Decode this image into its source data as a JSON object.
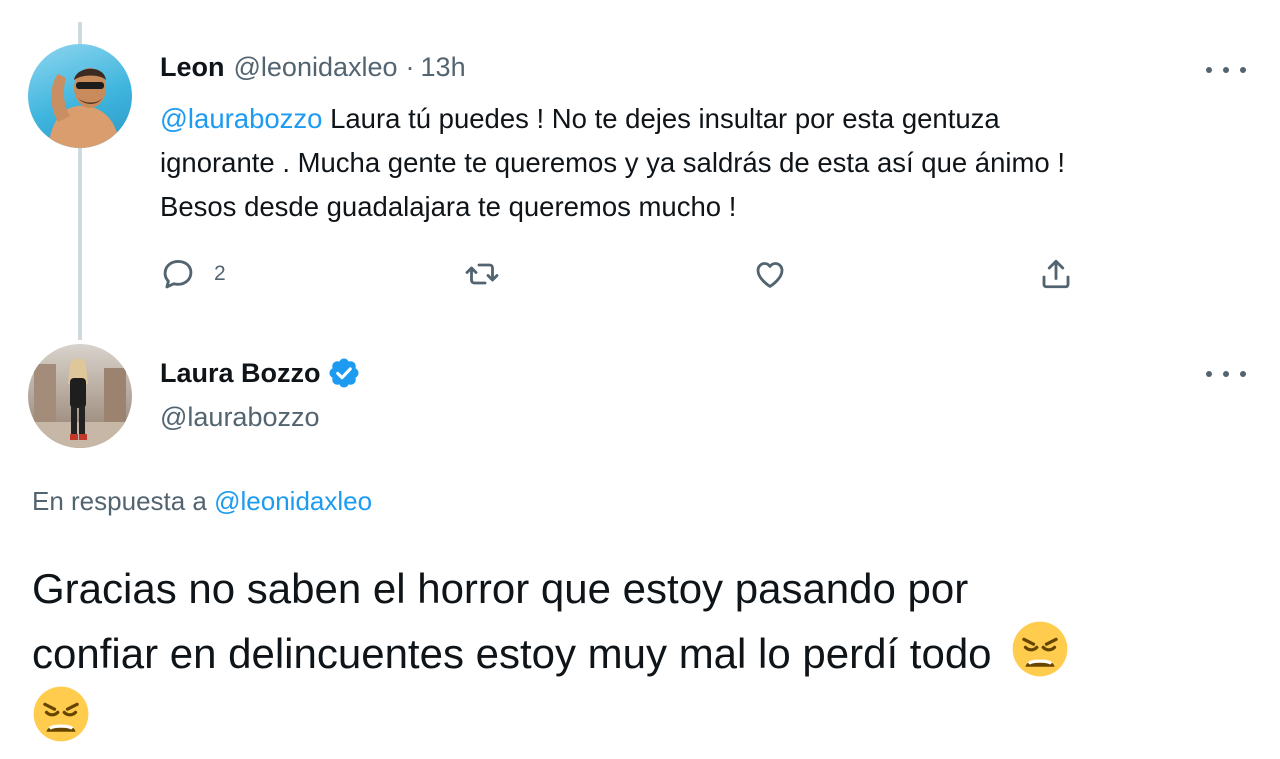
{
  "tweet": {
    "author_name": "Leon",
    "author_handle": "@leonidaxleo",
    "separator": "·",
    "time": "13h",
    "text_mention": "@laurabozzo",
    "text_line1_rest": " Laura tú puedes ! No te dejes insultar por esta gentuza",
    "text_line2": "ignorante . Mucha gente te queremos y ya saldrás de esta así que ánimo !",
    "text_line3": "Besos desde guadalajara te queremos mucho !",
    "reply_count": "2"
  },
  "reply": {
    "author_name": "Laura Bozzo",
    "author_handle": "@laurabozzo",
    "in_reply_prefix": "En respuesta a",
    "in_reply_handle": "@leonidaxleo",
    "text_line1": "Gracias no saben el horror que estoy pasando por",
    "text_line2": "confiar en delincuentes estoy muy mal lo perdí todo"
  },
  "icons": {
    "reply": "reply-icon",
    "retweet": "retweet-icon",
    "like": "heart-icon",
    "share": "share-icon",
    "more": "more-icon",
    "verified": "verified-badge-icon",
    "emoji": "weary-face-emoji"
  },
  "colors": {
    "accent": "#1d9bf0",
    "muted": "#536471",
    "text": "#0f1419",
    "thread_line": "#cfd9de"
  }
}
